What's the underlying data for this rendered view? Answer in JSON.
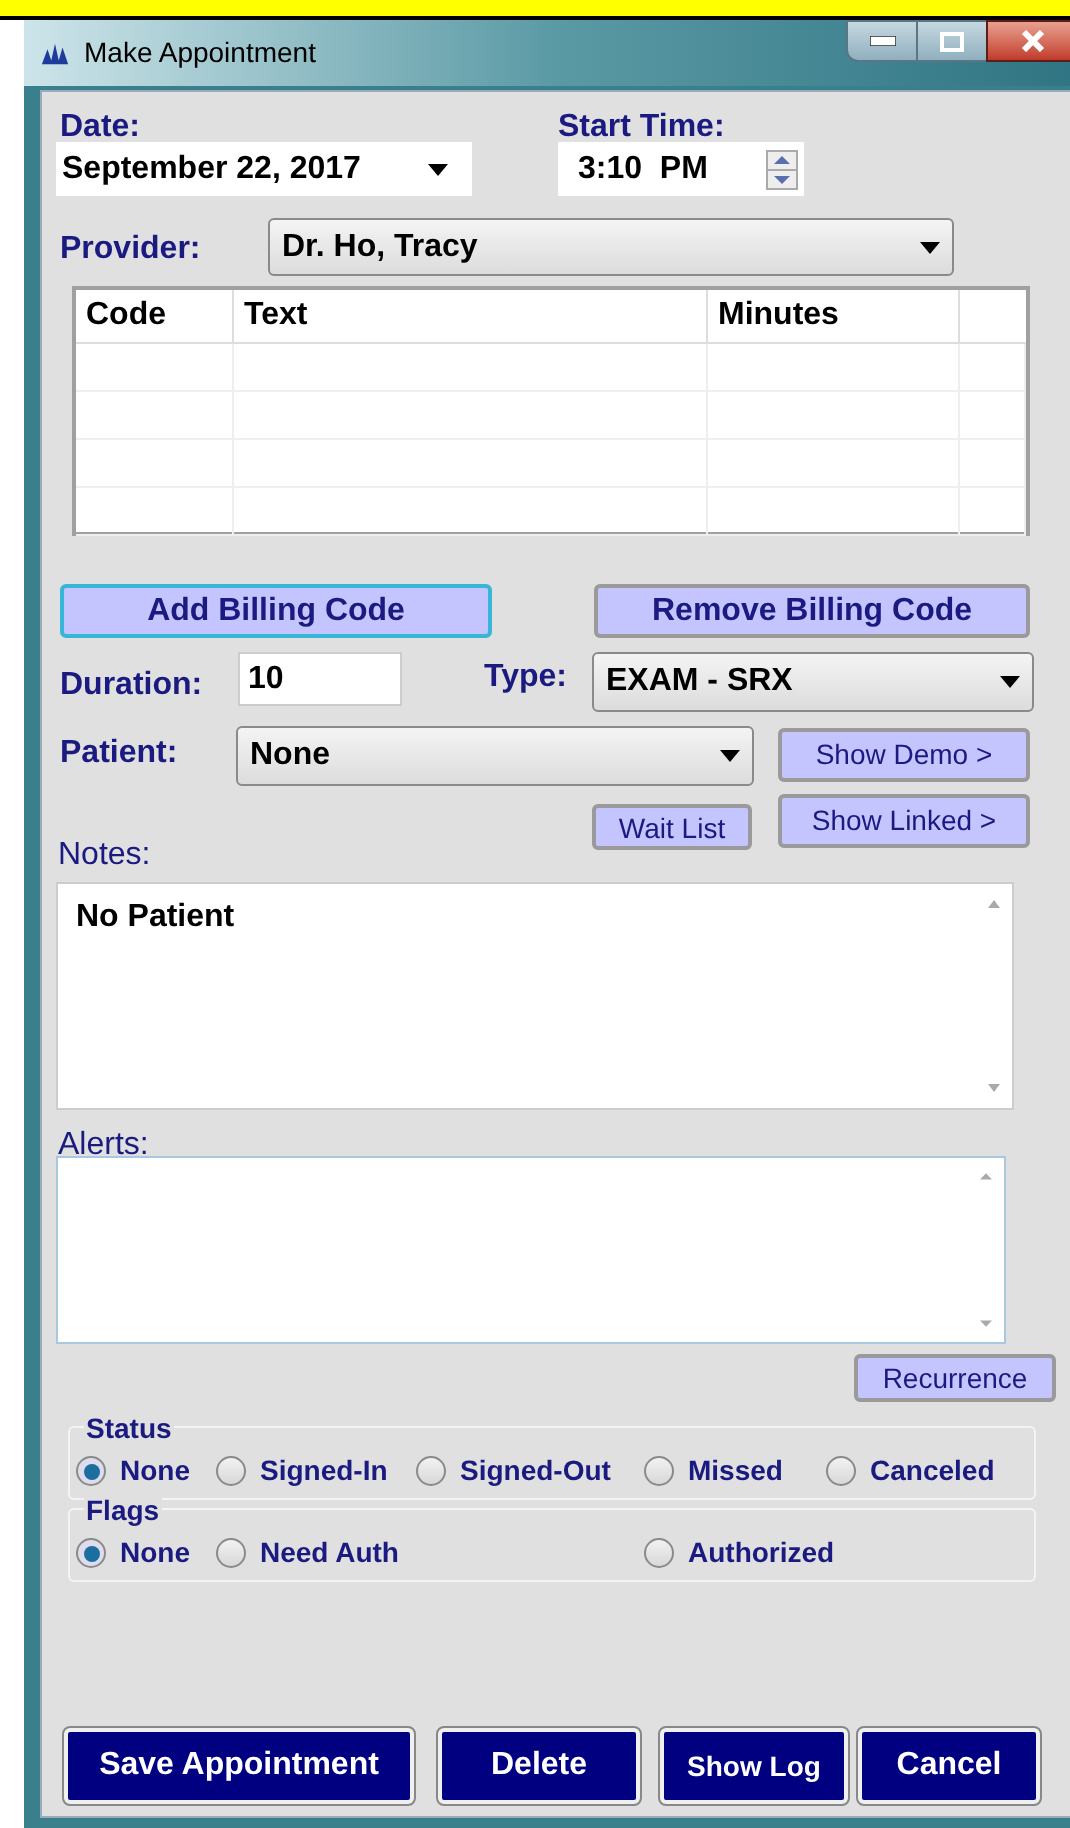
{
  "window": {
    "title": "Make Appointment"
  },
  "date": {
    "label": "Date:",
    "value": "September 22, 2017"
  },
  "start_time": {
    "label": "Start Time:",
    "value": "3:10  PM"
  },
  "provider": {
    "label": "Provider:",
    "value": "Dr. Ho, Tracy"
  },
  "billing_table": {
    "columns": [
      "Code",
      "Text",
      "Minutes"
    ]
  },
  "billing_buttons": [
    {
      "label": "Add Billing Code",
      "focused": true
    },
    {
      "label": "Remove Billing Code",
      "focused": false
    }
  ],
  "duration": {
    "label": "Duration:",
    "value": "10"
  },
  "type": {
    "label": "Type:",
    "value": "EXAM - SRX"
  },
  "patient": {
    "label": "Patient:",
    "value": "None"
  },
  "show_demo": "Show Demo >",
  "wait_list": "Wait List",
  "show_linked": "Show Linked >",
  "notes": {
    "label": "Notes:",
    "value": "No Patient"
  },
  "alerts": {
    "label": "Alerts:"
  },
  "recurrence": "Recurrence",
  "status": {
    "label": "Status",
    "options": [
      {
        "label": "None",
        "selected": true
      },
      {
        "label": "Signed-In",
        "selected": false
      },
      {
        "label": "Signed-Out",
        "selected": false
      },
      {
        "label": "Missed",
        "selected": false
      },
      {
        "label": "Canceled",
        "selected": false
      }
    ]
  },
  "flags": {
    "label": "Flags",
    "options": [
      {
        "label": "None",
        "selected": true
      },
      {
        "label": "Need Auth",
        "selected": false
      },
      {
        "label": "Authorized",
        "selected": false
      }
    ]
  },
  "actions": [
    "Save Appointment",
    "Delete",
    "Show Log",
    "Cancel"
  ]
}
